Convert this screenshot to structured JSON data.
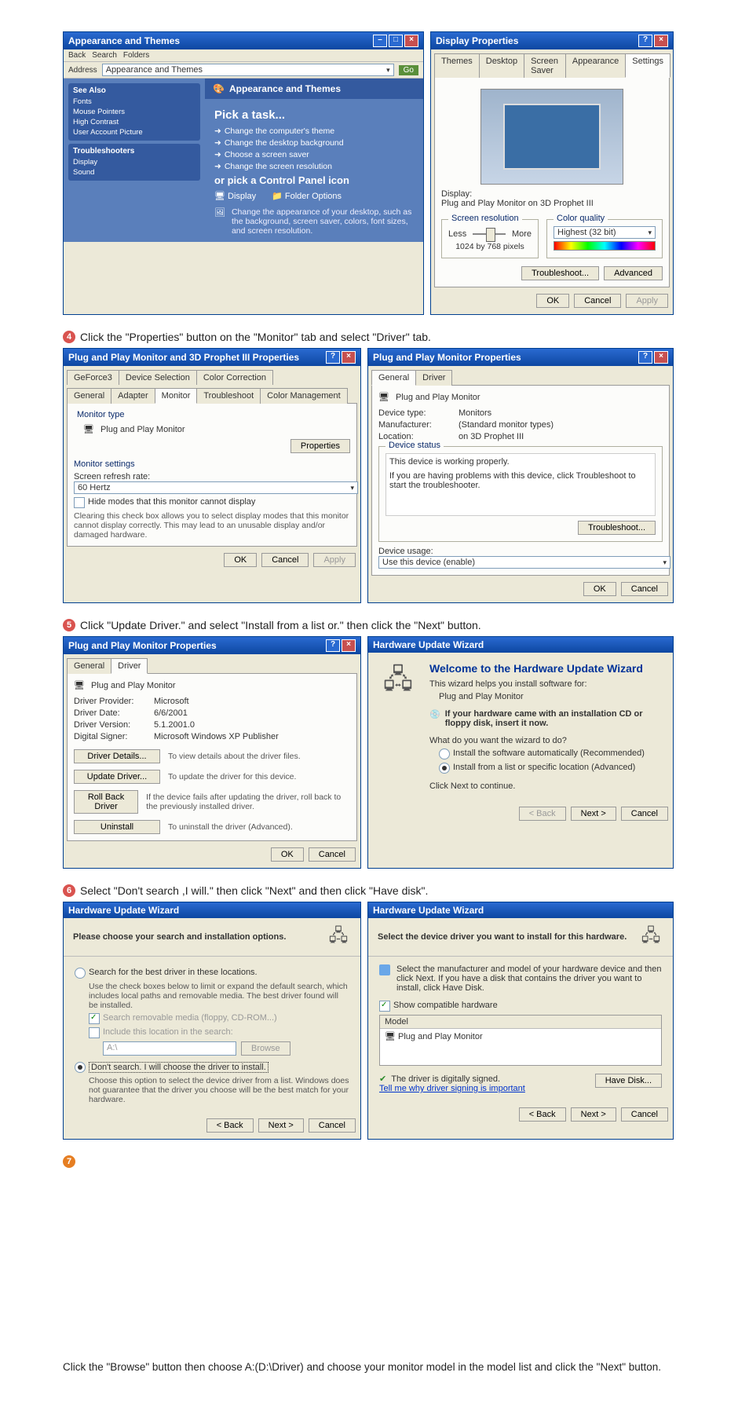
{
  "step3": {
    "left_window": {
      "title": "Appearance and Themes",
      "toolbar_back": "Back",
      "toolbar_search": "Search",
      "toolbar_folders": "Folders",
      "address": "Address",
      "address_val": "Appearance and Themes",
      "go": "Go",
      "side_block1_title": "See Also",
      "side_block1_items": [
        "Fonts",
        "Mouse Pointers",
        "High Contrast",
        "User Account Picture"
      ],
      "side_block2_title": "Troubleshooters",
      "side_block2_items": [
        "Display",
        "Sound"
      ],
      "main_icon_label": "Appearance and Themes",
      "pick_task": "Pick a task...",
      "task1": "Change the computer's theme",
      "task2": "Change the desktop background",
      "task3": "Choose a screen saver",
      "task4": "Change the screen resolution",
      "or_pick": "or pick a Control Panel icon",
      "cp_display": "Display",
      "cp_folder": "Folder Options",
      "cp_note": "Change the appearance of your desktop, such as the background, screen saver, colors, font sizes, and screen resolution."
    },
    "right_window": {
      "title": "Display Properties",
      "tabs": [
        "Themes",
        "Desktop",
        "Screen Saver",
        "Appearance",
        "Settings"
      ],
      "display_label": "Display:",
      "display_value": "Plug and Play Monitor on 3D Prophet III",
      "screen_res_label": "Screen resolution",
      "less": "Less",
      "more": "More",
      "res_value": "1024 by 768 pixels",
      "color_quality_label": "Color quality",
      "color_quality_value": "Highest (32 bit)",
      "troubleshoot": "Troubleshoot...",
      "advanced": "Advanced",
      "ok": "OK",
      "cancel": "Cancel",
      "apply": "Apply"
    }
  },
  "step4": {
    "caption": "Click the \"Properties\" button on the \"Monitor\" tab and select \"Driver\" tab.",
    "left_window": {
      "title": "Plug and Play Monitor and 3D Prophet III Properties",
      "tab_row1": [
        "GeForce3",
        "Device Selection",
        "Color Correction"
      ],
      "tab_row2": [
        "General",
        "Adapter",
        "Monitor",
        "Troubleshoot",
        "Color Management"
      ],
      "monitor_type_label": "Monitor type",
      "monitor_type_value": "Plug and Play Monitor",
      "properties_btn": "Properties",
      "monitor_settings_label": "Monitor settings",
      "refresh_label": "Screen refresh rate:",
      "refresh_value": "60 Hertz",
      "hide_modes": "Hide modes that this monitor cannot display",
      "hide_modes_note": "Clearing this check box allows you to select display modes that this monitor cannot display correctly. This may lead to an unusable display and/or damaged hardware.",
      "ok": "OK",
      "cancel": "Cancel",
      "apply": "Apply"
    },
    "right_window": {
      "title": "Plug and Play Monitor Properties",
      "tabs": [
        "General",
        "Driver"
      ],
      "icon_label": "Plug and Play Monitor",
      "dev_type_label": "Device type:",
      "dev_type_value": "Monitors",
      "manu_label": "Manufacturer:",
      "manu_value": "(Standard monitor types)",
      "loc_label": "Location:",
      "loc_value": "on 3D Prophet III",
      "status_title": "Device status",
      "status_line": "This device is working properly.",
      "status_note": "If you are having problems with this device, click Troubleshoot to start the troubleshooter.",
      "troubleshoot": "Troubleshoot...",
      "usage_label": "Device usage:",
      "usage_value": "Use this device (enable)",
      "ok": "OK",
      "cancel": "Cancel"
    }
  },
  "step5": {
    "caption": "Click \"Update Driver.\" and select \"Install from a list or.\" then click the \"Next\" button.",
    "left_window": {
      "title": "Plug and Play Monitor Properties",
      "tabs": [
        "General",
        "Driver"
      ],
      "icon_label": "Plug and Play Monitor",
      "provider_label": "Driver Provider:",
      "provider_value": "Microsoft",
      "date_label": "Driver Date:",
      "date_value": "6/6/2001",
      "version_label": "Driver Version:",
      "version_value": "5.1.2001.0",
      "signer_label": "Digital Signer:",
      "signer_value": "Microsoft Windows XP Publisher",
      "details_btn": "Driver Details...",
      "details_note": "To view details about the driver files.",
      "update_btn": "Update Driver...",
      "update_note": "To update the driver for this device.",
      "rollback_btn": "Roll Back Driver",
      "rollback_note": "If the device fails after updating the driver, roll back to the previously installed driver.",
      "uninstall_btn": "Uninstall",
      "uninstall_note": "To uninstall the driver (Advanced).",
      "ok": "OK",
      "cancel": "Cancel"
    },
    "right_window": {
      "title": "Hardware Update Wizard",
      "welcome": "Welcome to the Hardware Update Wizard",
      "helps": "This wizard helps you install software for:",
      "device": "Plug and Play Monitor",
      "cd_note": "If your hardware came with an installation CD or floppy disk, insert it now.",
      "prompt": "What do you want the wizard to do?",
      "opt1": "Install the software automatically (Recommended)",
      "opt2": "Install from a list or specific location (Advanced)",
      "click_next": "Click Next to continue.",
      "back": "< Back",
      "next": "Next >",
      "cancel": "Cancel"
    }
  },
  "step6": {
    "caption": "Select \"Don't search ,I will.\" then click \"Next\" and then click \"Have disk\".",
    "left_window": {
      "title": "Hardware Update Wizard",
      "header": "Please choose your search and installation options.",
      "opt_search": "Search for the best driver in these locations.",
      "search_note": "Use the check boxes below to limit or expand the default search, which includes local paths and removable media. The best driver found will be installed.",
      "chk1": "Search removable media (floppy, CD-ROM...)",
      "chk2": "Include this location in the search:",
      "path_value": "A:\\",
      "browse": "Browse",
      "opt_dont": "Don't search. I will choose the driver to install.",
      "dont_note": "Choose this option to select the device driver from a list. Windows does not guarantee that the driver you choose will be the best match for your hardware.",
      "back": "< Back",
      "next": "Next >",
      "cancel": "Cancel"
    },
    "right_window": {
      "title": "Hardware Update Wizard",
      "header": "Select the device driver you want to install for this hardware.",
      "note": "Select the manufacturer and model of your hardware device and then click Next. If you have a disk that contains the driver you want to install, click Have Disk.",
      "show_compat": "Show compatible hardware",
      "model": "Model",
      "model_item": "Plug and Play Monitor",
      "signed": "The driver is digitally signed.",
      "tell_me": "Tell me why driver signing is important",
      "have_disk": "Have Disk...",
      "back": "< Back",
      "next": "Next >",
      "cancel": "Cancel"
    }
  },
  "step7": {
    "caption": "Click the \"Browse\" button then choose A:(D:\\Driver) and choose your monitor model in the model list and click the \"Next\" button."
  }
}
